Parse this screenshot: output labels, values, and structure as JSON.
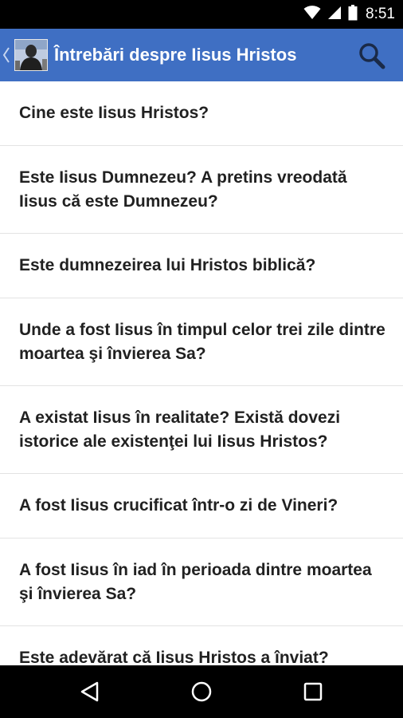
{
  "status_bar": {
    "time": "8:51",
    "icons": [
      "wifi-icon",
      "cell-signal-icon",
      "battery-icon"
    ]
  },
  "app_bar": {
    "title": "Întrebări despre Iisus Hristos",
    "icons": [
      "back-chevron-icon",
      "app-logo",
      "search-icon"
    ],
    "color": "#3f6fc3"
  },
  "questions": [
    {
      "label": "Cine este Iisus Hristos?"
    },
    {
      "label": "Este Iisus Dumnezeu? A pretins vreodată Iisus că este Dumnezeu?"
    },
    {
      "label": "Este dumnezeirea lui Hristos biblică?"
    },
    {
      "label": "Unde a fost Iisus în timpul celor trei zile dintre moartea şi învierea Sa?"
    },
    {
      "label": "A existat Iisus în realitate? Există dovezi istorice ale existenţei lui Iisus Hristos?"
    },
    {
      "label": "A fost Iisus crucificat într-o zi de Vineri?"
    },
    {
      "label": "A fost Iisus în iad în perioada dintre moartea şi învierea Sa?"
    },
    {
      "label": "Este adevărat că Iisus Hristos a înviat?"
    }
  ],
  "nav_bar": {
    "icons": [
      "back-triangle-icon",
      "home-circle-icon",
      "recents-square-icon"
    ]
  }
}
